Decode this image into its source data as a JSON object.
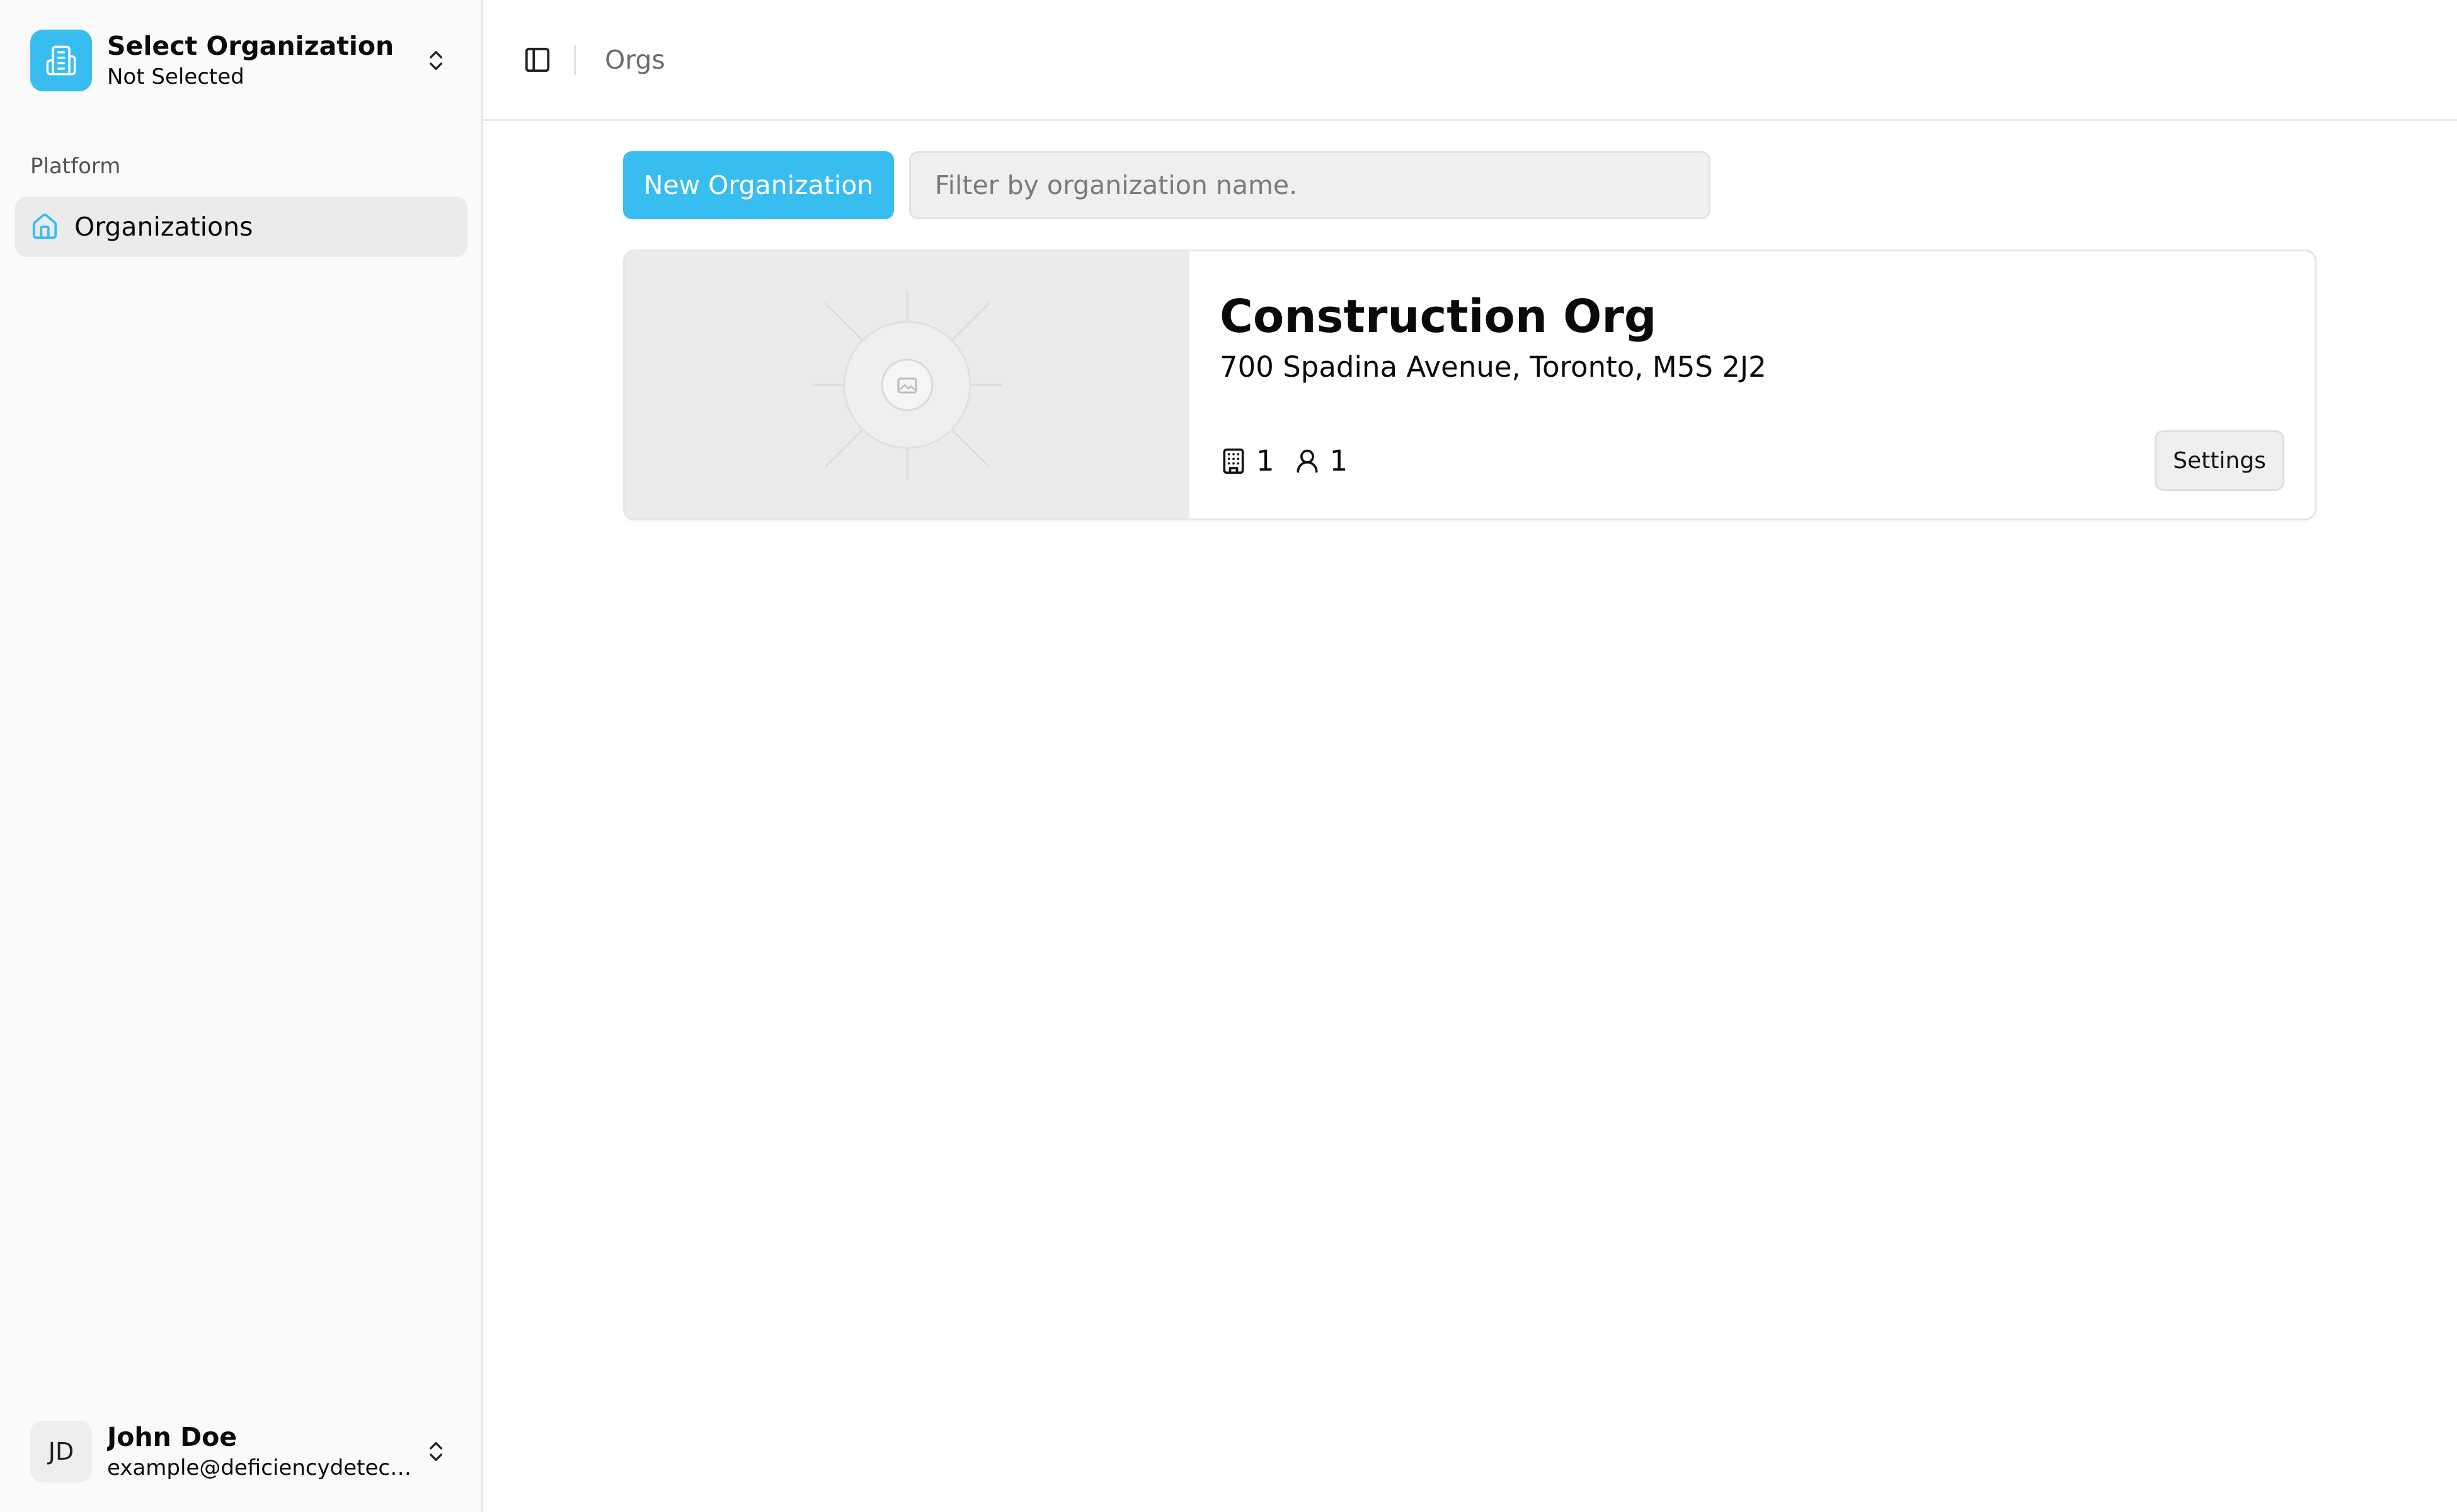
{
  "sidebar": {
    "org_switcher": {
      "title": "Select Organization",
      "subtitle": "Not Selected",
      "logo_icon": "building-icon"
    },
    "group_label": "Platform",
    "nav_items": [
      {
        "label": "Organizations",
        "icon": "home-icon",
        "active": true
      }
    ],
    "user": {
      "initials": "JD",
      "name": "John Doe",
      "email": "example@deficiencydetect...."
    }
  },
  "topbar": {
    "breadcrumb": "Orgs"
  },
  "toolbar": {
    "new_button_label": "New Organization",
    "filter_placeholder": "Filter by organization name."
  },
  "organizations": [
    {
      "name": "Construction Org",
      "address": "700 Spadina Avenue, Toronto, M5S 2J2",
      "buildings_count": "1",
      "members_count": "1",
      "settings_label": "Settings"
    }
  ],
  "colors": {
    "accent": "#38bdf0",
    "sidebar_bg": "#fafafa",
    "active_nav_bg": "#ebebeb"
  }
}
